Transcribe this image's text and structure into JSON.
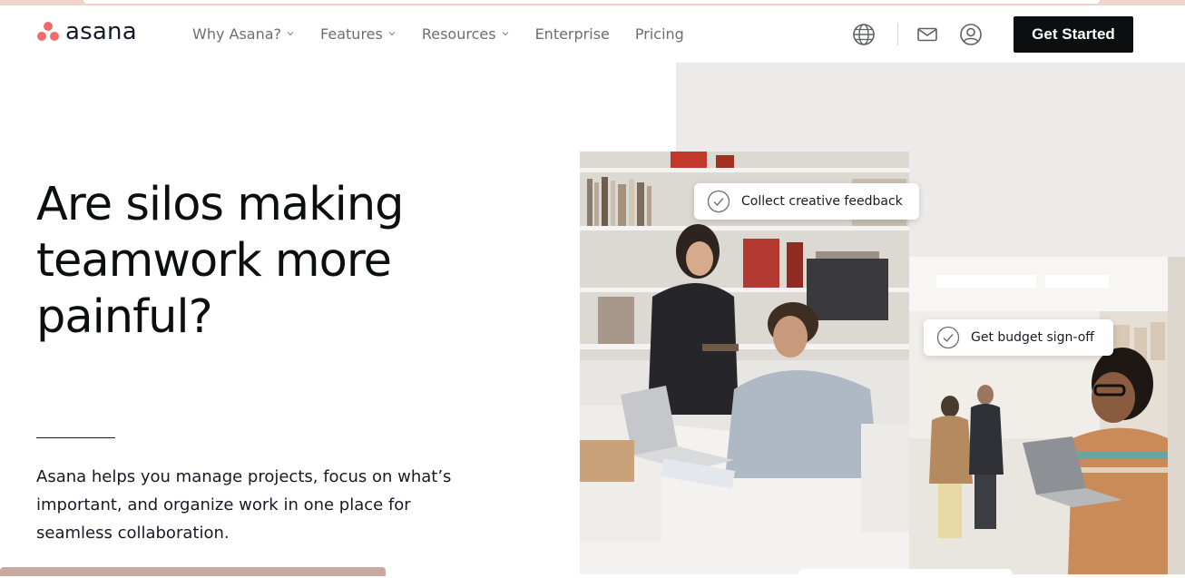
{
  "brand": {
    "name": "asana",
    "logo_color": "#f06a6a"
  },
  "nav": {
    "items": [
      {
        "label": "Why Asana?",
        "has_dropdown": true
      },
      {
        "label": "Features",
        "has_dropdown": true
      },
      {
        "label": "Resources",
        "has_dropdown": true
      },
      {
        "label": "Enterprise",
        "has_dropdown": false
      },
      {
        "label": "Pricing",
        "has_dropdown": false
      }
    ],
    "icons": [
      "globe-icon",
      "mail-icon",
      "user-icon"
    ],
    "cta_label": "Get Started"
  },
  "hero": {
    "headline": "Are silos making teamwork more painful?",
    "description": "Asana helps you manage projects, focus on what’s important, and organize work in one place for seamless collaboration.",
    "cards": [
      {
        "label": "Collect creative feedback",
        "icon": "check-circle-icon"
      },
      {
        "label": "Get budget sign-off",
        "icon": "check-circle-icon"
      }
    ]
  },
  "colors": {
    "cta_bg": "#0d0e10",
    "hero_panel": "#ecebea",
    "accent_strip": "#f0d3c9"
  }
}
